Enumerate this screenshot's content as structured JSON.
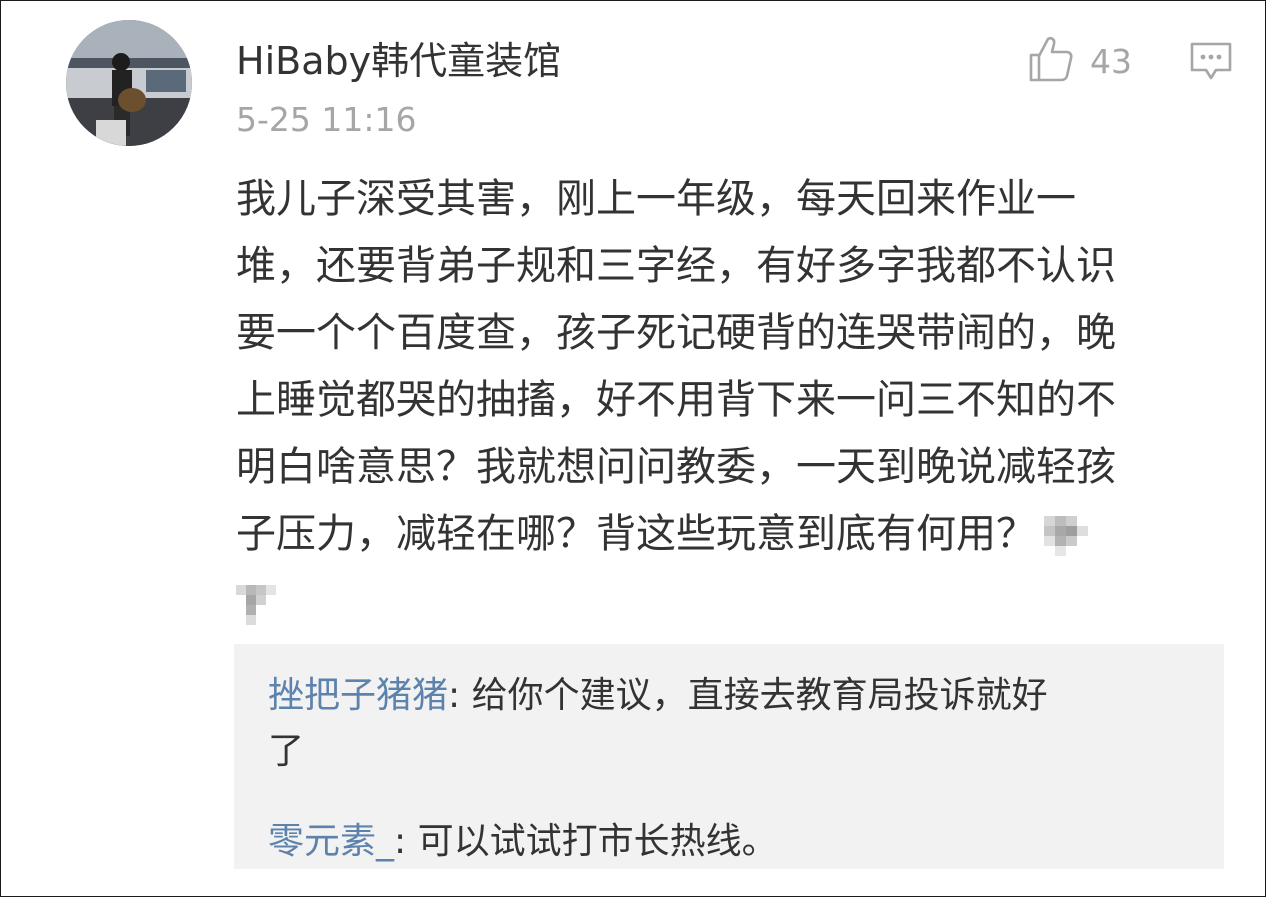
{
  "comment": {
    "username": "HiBaby韩代童装馆",
    "timestamp": "5-25 11:16",
    "like_count": "43",
    "body_lines": [
      "我儿子深受其害，刚上一年级，每天回来作业一",
      "堆，还要背弟子规和三字经，有好多字我都不认识",
      "要一个个百度查，孩子死记硬背的连哭带闹的，晚",
      "上睡觉都哭的抽搐，好不用背下来一问三不知的不",
      "明白啥意思？我就想问问教委，一天到晚说减轻孩",
      "子压力，减轻在哪？背这些玩意到底有何用？"
    ]
  },
  "icons": {
    "like": "thumbs-up-icon",
    "comment": "comment-bubble-icon",
    "avatar": "user-avatar-photo"
  },
  "colors": {
    "username_link": "#5d83ad",
    "text": "#333333",
    "muted": "#a6a6a6",
    "reply_bg": "#f2f2f2"
  },
  "replies": [
    {
      "user": "挫把子猪猪",
      "separator": ": ",
      "text_line1": "给你个建议，直接去教育局投诉就好",
      "text_line2": "了"
    },
    {
      "user": "零元素_",
      "separator": ": ",
      "text_line1": "可以试试打市长热线。"
    }
  ]
}
